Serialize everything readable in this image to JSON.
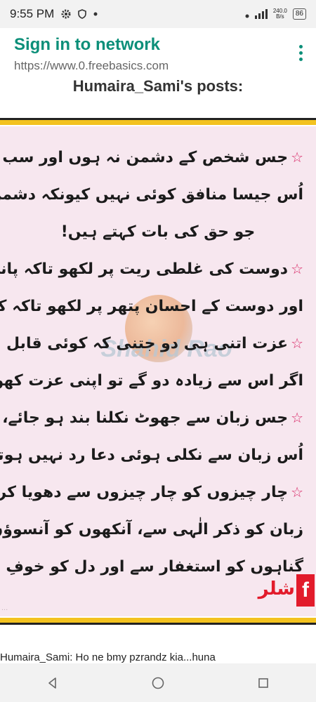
{
  "status_bar": {
    "time": "9:55 PM",
    "speed_value": "240.0",
    "speed_unit": "B/s",
    "battery": "86"
  },
  "header": {
    "title": "Sign in to network",
    "url": "https://www.0.freebasics.com"
  },
  "page": {
    "posts_title": "Humaira_Sami's posts:"
  },
  "post_image": {
    "lines": [
      "جس شخص کے دشمن نہ ہوں اور سب دوست ہوں",
      "اُس جیسا منافق کوئی نہیں کیونکہ دشمن اُس کے ہوتے ہیں،",
      "جو حق کی بات کہتے ہیں!",
      "دوست کی غلطی ریت پر لکھو تاکہ پانی اسے مٹا دے",
      "اور دوست کے احسان پتھر پر لکھو تاکہ کوئی اسے مٹا نہ سکے!",
      "عزت اتنی ہی دو جتنی کہ کوئی قابل ہو۔",
      "اگر اس سے زیادہ دو گے تو اپنی عزت کھو دو گے....",
      "جس زبان سے جھوٹ نکلنا بند ہو جائے،",
      "اُس زبان سے نکلی ہوئی دعا رد نہیں ہوتی",
      "چار چیزوں کو چار چیزوں سے دھویا کرو۔",
      "زبان کو ذکر الٰہی سے، آنکھوں کو آنسوؤں سے،",
      "گناہوں کو استغفار سے اور دل کو خوفِ خدا سے!"
    ],
    "star_lines": [
      0,
      3,
      5,
      7,
      9
    ],
    "watermark": "Shahid Rao",
    "corner_logo_letter": "f",
    "corner_logo_script": "شلر",
    "corner_left_text": "..."
  },
  "below_image": {
    "text": "Humaira_Sami: Ho ne bmy pzrandz kia...huna"
  },
  "colors": {
    "accent": "#0c8f79",
    "star": "#d92c6a",
    "band_yellow": "#f3c21f"
  },
  "icons": {
    "status": [
      "gear-icon",
      "shield-icon",
      "dot-icon",
      "signal-icon",
      "battery-icon"
    ],
    "nav": [
      "back-icon",
      "home-icon",
      "recents-icon"
    ]
  }
}
